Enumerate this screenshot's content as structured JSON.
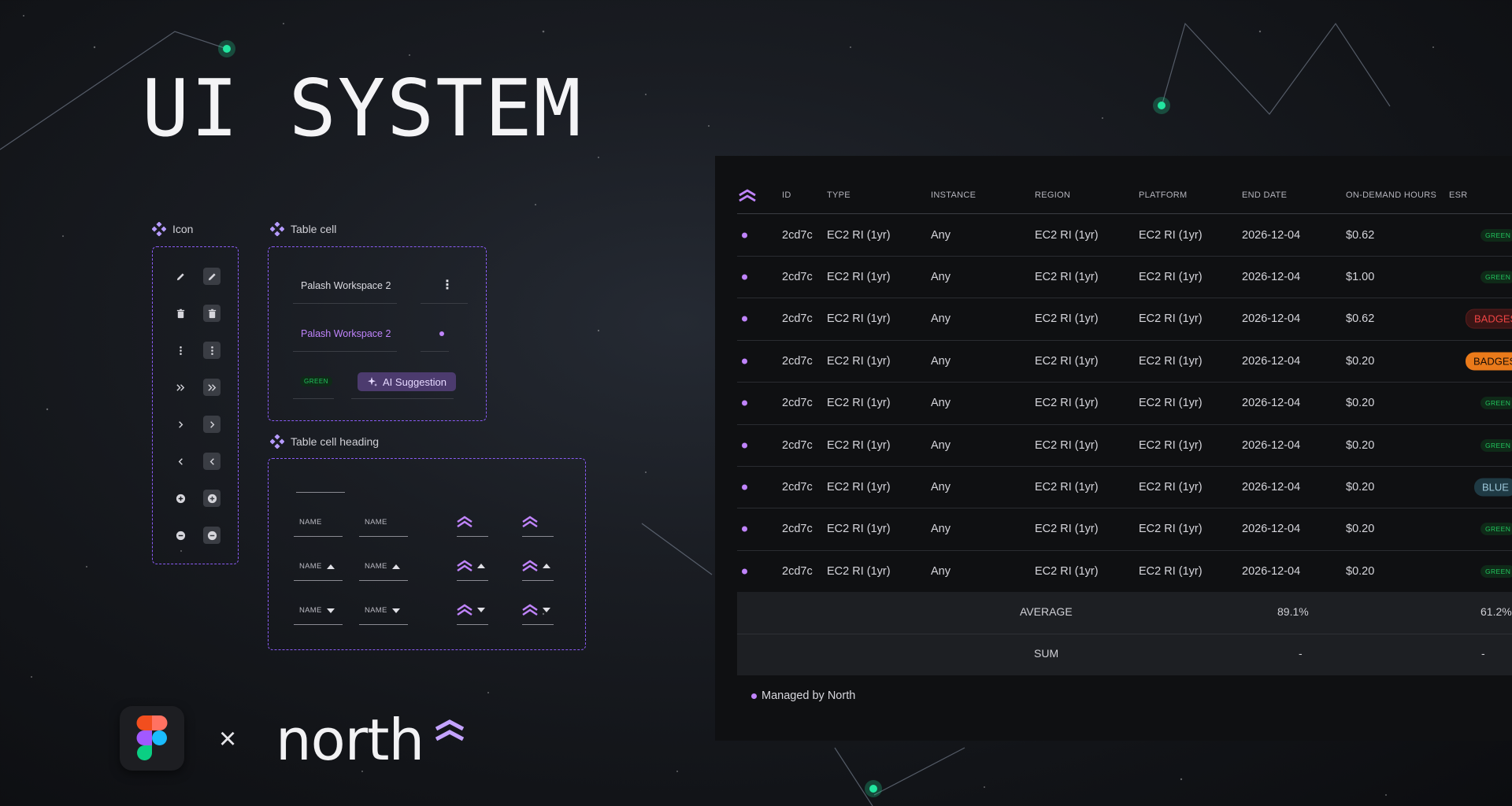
{
  "hero": {
    "title": "UI SYSTEM"
  },
  "sections": {
    "icon": "Icon",
    "table_cell": "Table cell",
    "table_cell_heading": "Table cell heading"
  },
  "icons": [
    {
      "name": "pencil-icon"
    },
    {
      "name": "trash-icon"
    },
    {
      "name": "kebab-icon"
    },
    {
      "name": "double-chevron-right-icon"
    },
    {
      "name": "chevron-right-icon"
    },
    {
      "name": "chevron-left-icon"
    },
    {
      "name": "plus-circle-icon"
    },
    {
      "name": "minus-circle-icon"
    }
  ],
  "table_cell_examples": {
    "workspace_default": "Palash Workspace 2",
    "workspace_active": "Palash Workspace 2",
    "green_badge": "GREEN",
    "ai_button": "AI Suggestion"
  },
  "heading_examples": {
    "name_label": "NAME"
  },
  "table": {
    "headers": [
      "ID",
      "TYPE",
      "INSTANCE",
      "REGION",
      "PLATFORM",
      "END DATE",
      "ON-DEMAND HOURS",
      "ESR"
    ],
    "rows": [
      {
        "id": "2cd7c",
        "type": "EC2 RI (1yr)",
        "instance": "Any",
        "region": "EC2 RI (1yr)",
        "platform": "EC2 RI (1yr)",
        "end_date": "2026-12-04",
        "hours": "$0.62",
        "esr": "GREEN",
        "esr_style": "green"
      },
      {
        "id": "2cd7c",
        "type": "EC2 RI (1yr)",
        "instance": "Any",
        "region": "EC2 RI (1yr)",
        "platform": "EC2 RI (1yr)",
        "end_date": "2026-12-04",
        "hours": "$1.00",
        "esr": "GREEN",
        "esr_style": "green"
      },
      {
        "id": "2cd7c",
        "type": "EC2 RI (1yr)",
        "instance": "Any",
        "region": "EC2 RI (1yr)",
        "platform": "EC2 RI (1yr)",
        "end_date": "2026-12-04",
        "hours": "$0.62",
        "esr": "BADGES",
        "esr_style": "red"
      },
      {
        "id": "2cd7c",
        "type": "EC2 RI (1yr)",
        "instance": "Any",
        "region": "EC2 RI (1yr)",
        "platform": "EC2 RI (1yr)",
        "end_date": "2026-12-04",
        "hours": "$0.20",
        "esr": "BADGES",
        "esr_style": "orange"
      },
      {
        "id": "2cd7c",
        "type": "EC2 RI (1yr)",
        "instance": "Any",
        "region": "EC2 RI (1yr)",
        "platform": "EC2 RI (1yr)",
        "end_date": "2026-12-04",
        "hours": "$0.20",
        "esr": "GREEN",
        "esr_style": "green"
      },
      {
        "id": "2cd7c",
        "type": "EC2 RI (1yr)",
        "instance": "Any",
        "region": "EC2 RI (1yr)",
        "platform": "EC2 RI (1yr)",
        "end_date": "2026-12-04",
        "hours": "$0.20",
        "esr": "GREEN",
        "esr_style": "green"
      },
      {
        "id": "2cd7c",
        "type": "EC2 RI (1yr)",
        "instance": "Any",
        "region": "EC2 RI (1yr)",
        "platform": "EC2 RI (1yr)",
        "end_date": "2026-12-04",
        "hours": "$0.20",
        "esr": "BLUE",
        "esr_style": "blue"
      },
      {
        "id": "2cd7c",
        "type": "EC2 RI (1yr)",
        "instance": "Any",
        "region": "EC2 RI (1yr)",
        "platform": "EC2 RI (1yr)",
        "end_date": "2026-12-04",
        "hours": "$0.20",
        "esr": "GREEN",
        "esr_style": "green"
      },
      {
        "id": "2cd7c",
        "type": "EC2 RI (1yr)",
        "instance": "Any",
        "region": "EC2 RI (1yr)",
        "platform": "EC2 RI (1yr)",
        "end_date": "2026-12-04",
        "hours": "$0.20",
        "esr": "GREEN",
        "esr_style": "green"
      }
    ],
    "summary": [
      {
        "label": "AVERAGE",
        "hours": "89.1%",
        "esr": "61.2%"
      },
      {
        "label": "SUM",
        "hours": "-",
        "esr": "-"
      }
    ],
    "footer_note": "Managed by North"
  },
  "branding": {
    "times": "×",
    "wordmark": "north"
  },
  "colors": {
    "accent_purple": "#c084fc",
    "dashed_border": "#8b5cf6",
    "star_green": "#22e6a0"
  }
}
